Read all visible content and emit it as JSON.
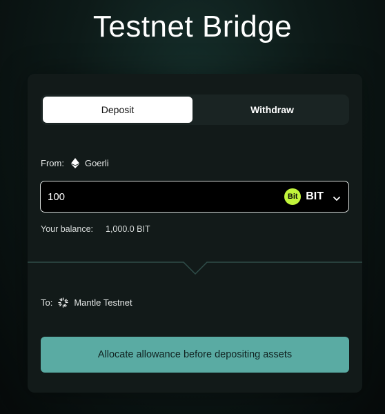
{
  "page": {
    "title": "Testnet Bridge"
  },
  "tabs": [
    {
      "label": "Deposit",
      "active": true
    },
    {
      "label": "Withdraw",
      "active": false
    }
  ],
  "from": {
    "label": "From:",
    "network": "Goerli",
    "icon": "ethereum-icon"
  },
  "amount": {
    "value": "100",
    "placeholder": ""
  },
  "token": {
    "logo_text": "Bit",
    "symbol": "BIT",
    "icon": "bit-token-icon",
    "logo_color": "#c2f53b"
  },
  "balance": {
    "label": "Your balance:",
    "value": "1,000.0 BIT"
  },
  "to": {
    "label": "To:",
    "network": "Mantle Testnet",
    "icon": "mantle-icon"
  },
  "action": {
    "label": "Allocate allowance before depositing assets",
    "color": "#5aaba3"
  },
  "colors": {
    "card_bg": "#121a19",
    "divider": "#2f4d49"
  }
}
